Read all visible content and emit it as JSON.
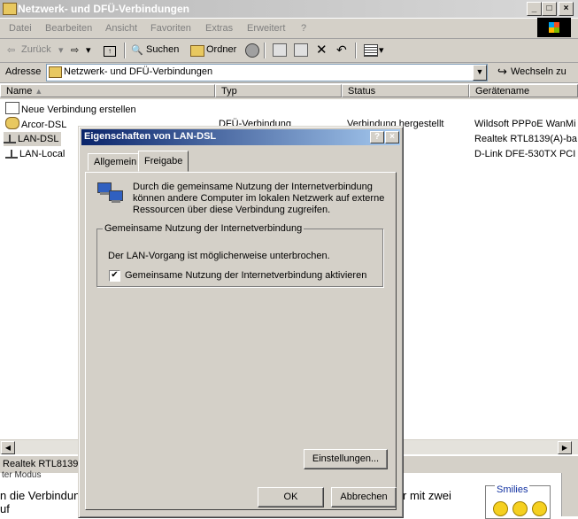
{
  "window": {
    "title": "Netzwerk- und DFÜ-Verbindungen",
    "controls": [
      "_",
      "□",
      "×"
    ]
  },
  "menu": [
    "Datei",
    "Bearbeiten",
    "Ansicht",
    "Favoriten",
    "Extras",
    "Erweitert",
    "?"
  ],
  "toolbar": {
    "back": "Zurück",
    "search": "Suchen",
    "folders": "Ordner"
  },
  "address": {
    "label": "Adresse",
    "value": "Netzwerk- und DFÜ-Verbindungen",
    "go": "Wechseln zu"
  },
  "columns": [
    "Name",
    "Typ",
    "Status",
    "Gerätename"
  ],
  "rows": [
    {
      "name": "Neue Verbindung erstellen",
      "type": "",
      "status": "",
      "device": ""
    },
    {
      "name": "Arcor-DSL",
      "type": "DFÜ-Verbindung",
      "status": "Verbindung hergestellt",
      "device": "Wildsoft PPPoE WanMi"
    },
    {
      "name": "LAN-DSL",
      "type": "",
      "status": "",
      "device": "Realtek RTL8139(A)-ba"
    },
    {
      "name": "LAN-Local",
      "type": "",
      "status": "",
      "device": "D-Link DFE-530TX PCI"
    }
  ],
  "statusbar": {
    "text": "Realtek RTL8139("
  },
  "background_text": {
    "line1": "n die Verbindun",
    "line1_right": "r mit zwei",
    "line2": "uf",
    "top_fragment": "ter Modus",
    "smilies_label": "Smilies"
  },
  "dialog": {
    "title": "Eigenschaften von LAN-DSL",
    "help_btn": "?",
    "close_btn": "×",
    "tabs": [
      "Allgemein",
      "Freigabe"
    ],
    "active_tab": "Freigabe",
    "intro": "Durch die gemeinsame Nutzung der Internetverbindung können andere Computer im lokalen Netzwerk auf externe Ressourcen über diese Verbindung zugreifen.",
    "group_title": "Gemeinsame Nutzung der Internetverbindung",
    "warning": "Der LAN-Vorgang ist möglicherweise unterbrochen.",
    "checkbox_label": "Gemeinsame Nutzung der Internetverbindung aktivieren",
    "checkbox_checked": true,
    "settings_btn": "Einstellungen...",
    "ok_btn": "OK",
    "cancel_btn": "Abbrechen"
  }
}
